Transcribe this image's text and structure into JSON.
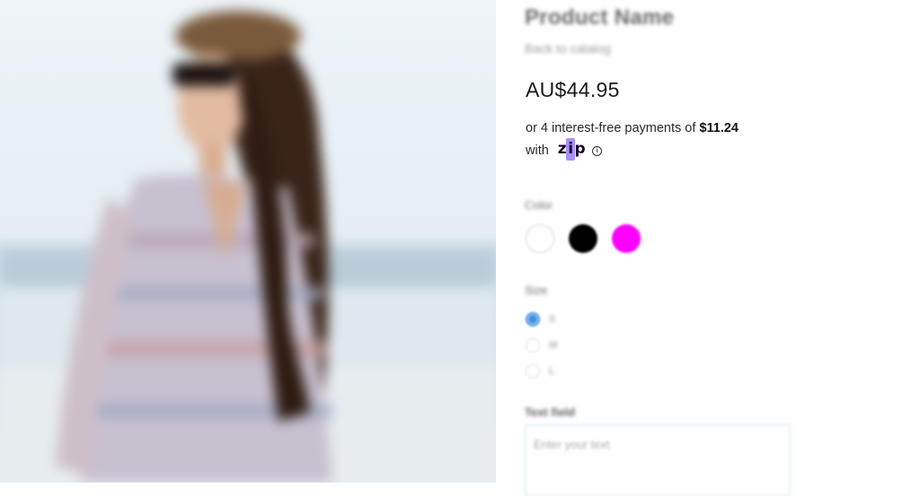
{
  "product": {
    "title": "Product Name",
    "back_link": "Back to catalog",
    "price": "AU$44.95"
  },
  "zip": {
    "prefix": "or 4 interest-free payments of",
    "amount": "$11.24",
    "with": "with",
    "logo_a": "z",
    "logo_b": "i",
    "logo_c": "p",
    "info": "i"
  },
  "color_section": {
    "label": "Color",
    "swatches": [
      {
        "name": "White",
        "hex": "#ffffff"
      },
      {
        "name": "Black",
        "hex": "#000000"
      },
      {
        "name": "Magenta",
        "hex": "#ff00ff"
      }
    ]
  },
  "size_section": {
    "label": "Size",
    "options": [
      "S",
      "M",
      "L"
    ],
    "selected": "S"
  },
  "text_field": {
    "label": "Text field",
    "placeholder": "Enter your text"
  },
  "colors": {
    "accent_radio": "#3b8de0",
    "zip_brand": "#aa8fff"
  }
}
